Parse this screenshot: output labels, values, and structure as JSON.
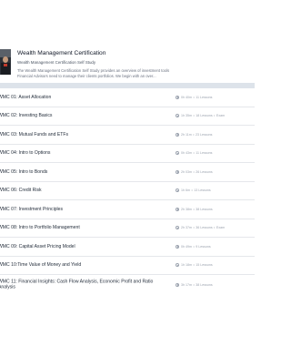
{
  "course": {
    "title": "Wealth Management Certification",
    "subtitle": "Wealth Management Certification Self Study",
    "description_line1": "The Wealth Management Certification Self Study provides an overview of investment tools",
    "description_line2": "Financial Advisors need to manage their clients portfolios. We begin with an over..."
  },
  "modules": [
    {
      "title": "WMC 01: Asset Allocation",
      "duration": "0h 40m",
      "lessons": "11 Lessons",
      "extra": ""
    },
    {
      "title": "WMC 02: Investing Basics",
      "duration": "1h 35m",
      "lessons": "18 Lessons",
      "extra": "Exam"
    },
    {
      "title": "WMC 03: Mutual Funds and ETFs",
      "duration": "2h 11m",
      "lessons": "23 Lessons",
      "extra": ""
    },
    {
      "title": "WMC 04: Intro to Options",
      "duration": "0h 43m",
      "lessons": "11 Lessons",
      "extra": ""
    },
    {
      "title": "WMC 05: Intro to Bonds",
      "duration": "2h 03m",
      "lessons": "26 Lessons",
      "extra": ""
    },
    {
      "title": "WMC 06: Credit Risk",
      "duration": "1h 6m",
      "lessons": "13 Lessons",
      "extra": ""
    },
    {
      "title": "WMC 07: Investment Principles",
      "duration": "2h 38m",
      "lessons": "38 Lessons",
      "extra": ""
    },
    {
      "title": "WMC 08: Intro to Portfolio Management",
      "duration": "2h 37m",
      "lessons": "36 Lessons",
      "extra": "Exam"
    },
    {
      "title": "WMC 09: Capital Asset Pricing Model",
      "duration": "0h 49m",
      "lessons": "9 Lessons",
      "extra": ""
    },
    {
      "title": "WMC 10:Time Value of Money and Yield",
      "duration": "1h 18m",
      "lessons": "15 Lessons",
      "extra": ""
    },
    {
      "title": "WMC 11: Financial Insights: Cash Flow Analysis, Economic Profit and Ratio Analysis",
      "duration": "3h 17m",
      "lessons": "38 Lessons",
      "extra": ""
    }
  ]
}
